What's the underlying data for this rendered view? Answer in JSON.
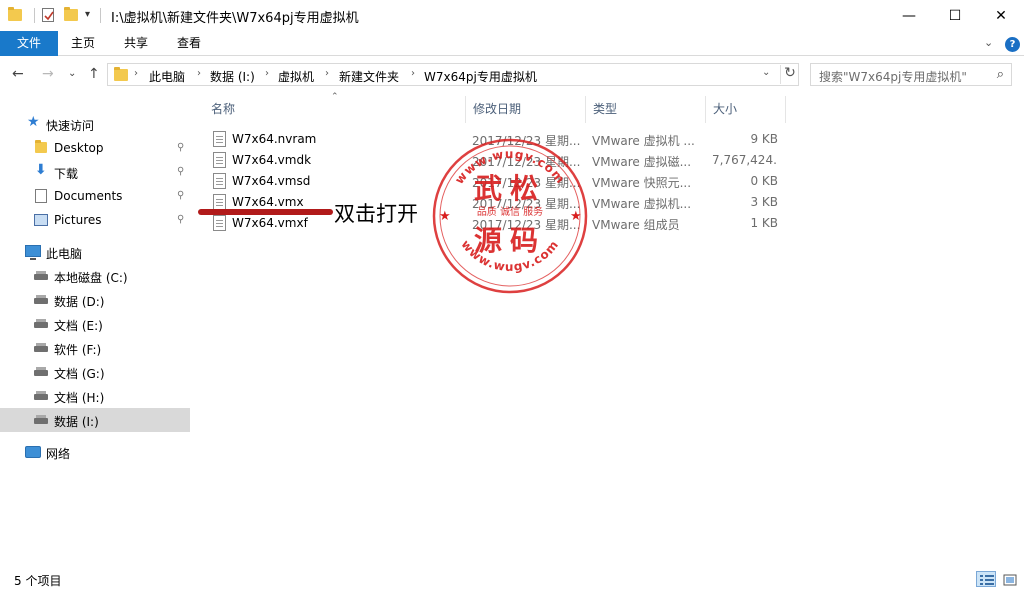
{
  "window": {
    "title": "I:\\虚拟机\\新建文件夹\\W7x64pj专用虚拟机",
    "minimize_glyph": "—",
    "maximize_glyph": "☐",
    "close_glyph": "✕"
  },
  "ribbon": {
    "tabs": [
      "文件",
      "主页",
      "共享",
      "查看"
    ],
    "collapse_glyph": "⌄",
    "help_glyph": "?"
  },
  "nav": {
    "back_glyph": "←",
    "forward_glyph": "→",
    "recent_glyph": "⌄",
    "up_glyph": "↑"
  },
  "address": {
    "crumbs": [
      "此电脑",
      "数据 (I:)",
      "虚拟机",
      "新建文件夹",
      "W7x64pj专用虚拟机"
    ],
    "separator": "›",
    "dropdown_glyph": "⌄",
    "refresh_glyph": "↻"
  },
  "search": {
    "placeholder": "搜索\"W7x64pj专用虚拟机\"",
    "icon_glyph": "⌕"
  },
  "sidebar": {
    "items": [
      {
        "label": "快速访问",
        "icon": "star-icon"
      },
      {
        "label": "Desktop",
        "icon": "folder-icon",
        "pinned": true
      },
      {
        "label": "下载",
        "icon": "download-icon",
        "pinned": true
      },
      {
        "label": "Documents",
        "icon": "documents-icon",
        "pinned": true
      },
      {
        "label": "Pictures",
        "icon": "pictures-icon",
        "pinned": true
      },
      {
        "label": "此电脑",
        "icon": "computer-icon"
      },
      {
        "label": "本地磁盘 (C:)",
        "icon": "drive-icon"
      },
      {
        "label": "数据 (D:)",
        "icon": "drive-icon"
      },
      {
        "label": "文档 (E:)",
        "icon": "drive-icon"
      },
      {
        "label": "软件 (F:)",
        "icon": "drive-icon"
      },
      {
        "label": "文档 (G:)",
        "icon": "drive-icon"
      },
      {
        "label": "文档 (H:)",
        "icon": "drive-icon"
      },
      {
        "label": "数据 (I:)",
        "icon": "drive-icon",
        "selected": true
      },
      {
        "label": "网络",
        "icon": "network-icon"
      }
    ],
    "pin_glyph": "📌"
  },
  "columns": {
    "name": "名称",
    "date": "修改日期",
    "type": "类型",
    "size": "大小",
    "sort_glyph": "⌃"
  },
  "files": [
    {
      "name": "W7x64.nvram",
      "date": "2017/12/23 星期...",
      "type": "VMware 虚拟机 ...",
      "size": "9 KB"
    },
    {
      "name": "W7x64.vmdk",
      "date": "2017/12/23 星期...",
      "type": "VMware 虚拟磁...",
      "size": "7,767,424..."
    },
    {
      "name": "W7x64.vmsd",
      "date": "2017/12/23 星期...",
      "type": "VMware 快照元...",
      "size": "0 KB"
    },
    {
      "name": "W7x64.vmx",
      "date": "2017/12/23 星期...",
      "type": "VMware 虚拟机...",
      "size": "3 KB"
    },
    {
      "name": "W7x64.vmxf",
      "date": "2017/12/23 星期...",
      "type": "VMware 组成员",
      "size": "1 KB"
    }
  ],
  "annotation": {
    "text": "双击打开",
    "line_color": "#b11a1a"
  },
  "watermark": {
    "top_arc": "www.wugv.com",
    "bottom_arc": "www.wugv.com",
    "line1": "武松",
    "line2": "源码",
    "motto": "品质 诚信 服务",
    "color": "#d81e1e"
  },
  "status": {
    "item_count": "5 个项目"
  },
  "colors": {
    "accent": "#1979ca",
    "selected_bg": "#d9d9d9",
    "header_text": "#4c607a"
  }
}
